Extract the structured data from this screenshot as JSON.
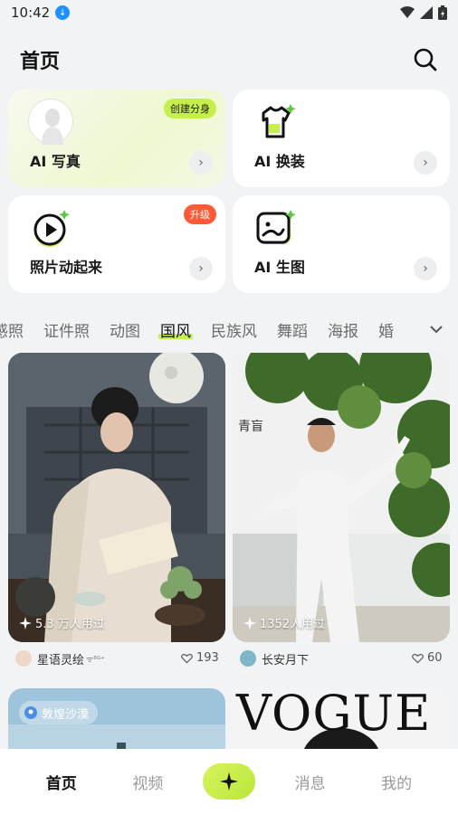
{
  "status": {
    "time": "10:42"
  },
  "header": {
    "title": "首页"
  },
  "features": [
    {
      "label": "AI 写真",
      "badge": "创建分身"
    },
    {
      "label": "AI 换装"
    },
    {
      "label": "照片动起来",
      "badge": "升级"
    },
    {
      "label": "AI 生图"
    }
  ],
  "tabs": [
    "感照",
    "证件照",
    "动图",
    "国风",
    "民族风",
    "舞蹈",
    "海报",
    "婚"
  ],
  "active_tab": "国风",
  "cards": [
    {
      "usage": "5.3 万人用过",
      "author": "星语灵绘",
      "author_suffix": "ᯤ⁶ᴳ⁺",
      "likes": "193"
    },
    {
      "usage": "1352人用过",
      "author": "长安月下",
      "likes": "60"
    },
    {
      "location": "敦煌沙漠"
    },
    {
      "magazine": "VOGUE"
    }
  ],
  "nav": {
    "home": "首页",
    "video": "视频",
    "messages": "消息",
    "mine": "我的"
  },
  "colors": {
    "accent": "#c5ef4a",
    "badge_red": "#ff5a36"
  }
}
